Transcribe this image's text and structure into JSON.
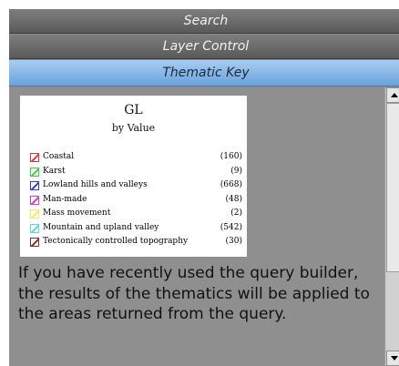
{
  "tabs": {
    "search": "Search",
    "layer_control": "Layer Control",
    "thematic_key": "Thematic Key"
  },
  "legend": {
    "title": "GL",
    "subtitle": "by Value",
    "items": [
      {
        "label": "Coastal",
        "count": "(160)",
        "color": "#e8343f"
      },
      {
        "label": "Karst",
        "count": "(9)",
        "color": "#3fcf3f"
      },
      {
        "label": "Lowland hills and valleys",
        "count": "(668)",
        "color": "#3a3ad6"
      },
      {
        "label": "Man-made",
        "count": "(48)",
        "color": "#d63ad6"
      },
      {
        "label": "Mass movement",
        "count": "(2)",
        "color": "#f0f05a"
      },
      {
        "label": "Mountain and upland valley",
        "count": "(542)",
        "color": "#5ad8e8"
      },
      {
        "label": "Tectonically controlled topography",
        "count": "(30)",
        "color": "#8a2a2a"
      }
    ]
  },
  "body_text": "If you have recently used the query builder, the results of the thematics will be applied to the areas returned from the query."
}
